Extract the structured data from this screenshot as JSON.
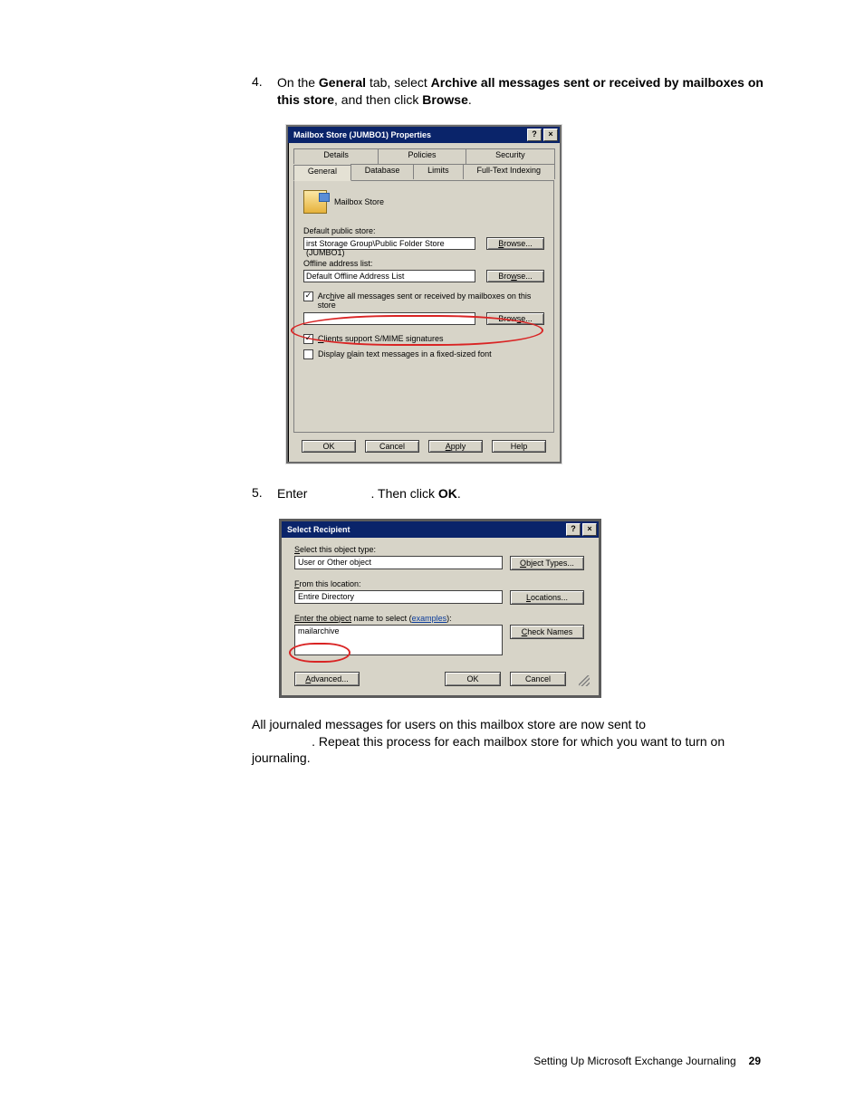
{
  "step4": {
    "num": "4.",
    "pre": "On the ",
    "bold1": "General",
    "mid1": " tab, select ",
    "bold2": "Archive all messages sent or received by mailboxes on this store",
    "mid2": ", and then click ",
    "bold3": "Browse",
    "post": "."
  },
  "dlg1": {
    "title": "Mailbox Store (JUMBO1) Properties",
    "tabs_row1": [
      "Details",
      "Policies",
      "Security"
    ],
    "tabs_row2": [
      "General",
      "Database",
      "Limits",
      "Full-Text Indexing"
    ],
    "mbx_label": "Mailbox Store",
    "default_public_store_label": "Default public store:",
    "default_public_store_value": "irst Storage Group\\Public Folder Store (JUMBO1)",
    "browse": "Browse...",
    "offline_label": "Offline address list:",
    "offline_value": "Default Offline Address List",
    "archive_chk": "Archive all messages sent or received by mailboxes on this store",
    "archive_path_value": "",
    "smime_chk": "Clients support S/MIME signatures",
    "plainfont_chk": "Display plain text messages in a fixed-sized font",
    "ok": "OK",
    "cancel": "Cancel",
    "apply": "Apply",
    "help": "Help"
  },
  "step5": {
    "num": "5.",
    "pre": "Enter ",
    "blank": "                 ",
    "mid": ". Then click ",
    "bold": "OK",
    "post": "."
  },
  "dlg2": {
    "title": "Select Recipient",
    "obj_type_label": "Select this object type:",
    "obj_type_value": "User or Other object",
    "obj_types_btn": "Object Types...",
    "loc_label": "From this location:",
    "loc_value": "Entire Directory",
    "loc_btn": "Locations...",
    "name_label_pre": "Enter the object",
    "name_label_post": " name to select (",
    "name_label_link": "examples",
    "name_label_end": "):",
    "name_value": "mailarchive",
    "check_names": "Check Names",
    "advanced": "Advanced...",
    "ok": "OK",
    "cancel": "Cancel"
  },
  "closing": {
    "line1": "All journaled messages for users on this mailbox store are now sent to ",
    "line2_blank": "                 ",
    "line2_rest": ". Repeat this process for each mailbox store for which you want to turn on journaling."
  },
  "footer": {
    "text": "Setting Up Microsoft Exchange Journaling",
    "page": "29"
  }
}
